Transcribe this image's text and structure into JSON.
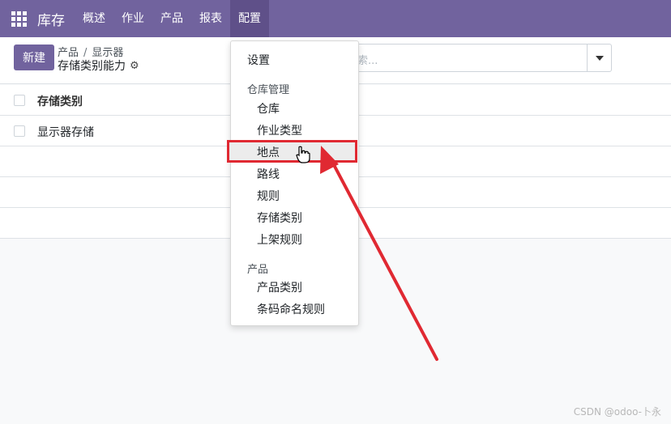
{
  "navbar": {
    "brand": "库存",
    "menus": [
      "概述",
      "作业",
      "产品",
      "报表",
      "配置"
    ]
  },
  "control": {
    "new_button": "新建",
    "breadcrumb_parent": "产品",
    "breadcrumb_sep": "/",
    "breadcrumb_child": "显示器",
    "title": "存储类别能力",
    "search_placeholder": "索..."
  },
  "list": {
    "header": "存储类别",
    "rows": [
      "显示器存储"
    ]
  },
  "dropdown": {
    "settings": "设置",
    "warehouse_header": "仓库管理",
    "warehouse_items": [
      "仓库",
      "作业类型",
      "地点",
      "路线",
      "规则",
      "存储类别",
      "上架规则"
    ],
    "product_header": "产品",
    "product_items": [
      "产品类别",
      "条码命名规则"
    ]
  },
  "annotation": {
    "color": "#e02932"
  },
  "watermark": "CSDN @odoo-卜永"
}
